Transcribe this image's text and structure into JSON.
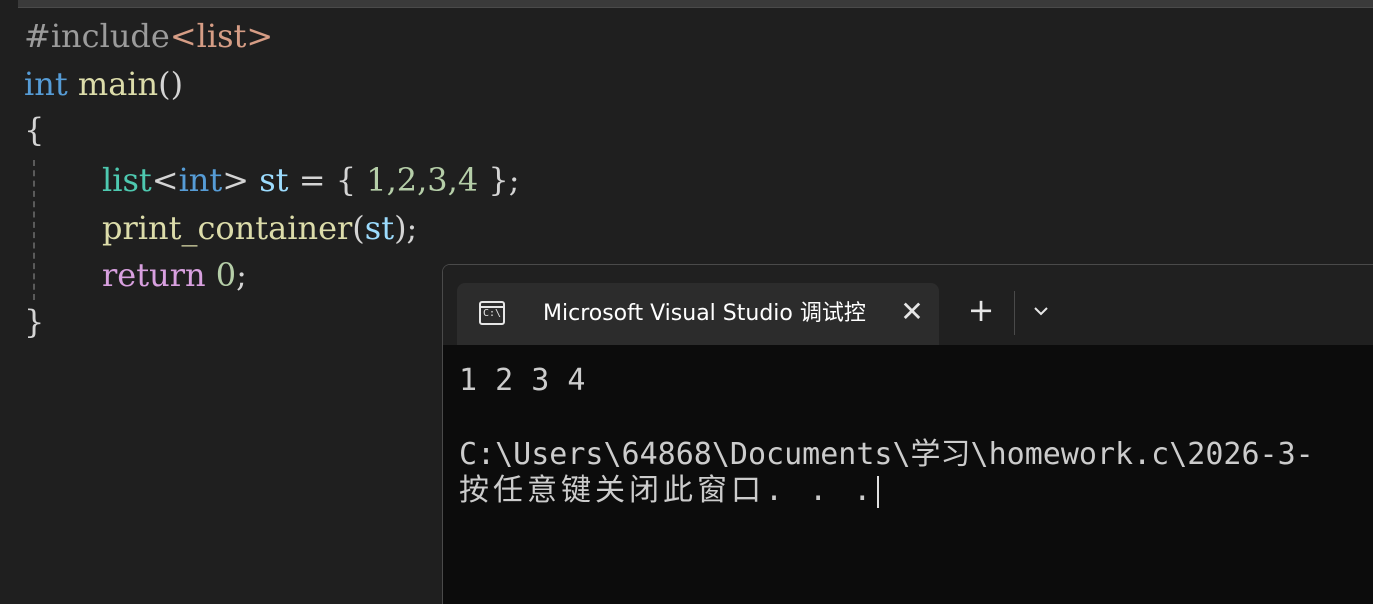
{
  "editor": {
    "lines": {
      "include_directive": "#include",
      "include_header": "<list>",
      "main_type": "int",
      "main_name": "main",
      "main_parens": "()",
      "open_brace": "{",
      "list_type": "list",
      "template_open": "<",
      "template_type": "int",
      "template_close": ">",
      "var_name": "st",
      "assign": " = { ",
      "init_values": "1,2,3,4",
      "init_close": " };",
      "call_name": "print_container",
      "call_open": "(",
      "call_arg": "st",
      "call_close": ");",
      "return_kw": "return",
      "return_value": "0",
      "return_semicolon": ";",
      "close_brace": "}"
    }
  },
  "terminal": {
    "tab_title": "Microsoft Visual Studio 调试控",
    "icons": {
      "tab_icon": "console-icon",
      "close": "close-icon",
      "new_tab": "plus-icon",
      "dropdown": "chevron-down-icon"
    },
    "close_glyph": "✕",
    "new_tab_glyph": "+",
    "output_line": "1 2 3 4",
    "path_line": "C:\\Users\\64868\\Documents\\学习\\homework.c\\2026-3-",
    "prompt_line": "按任意键关闭此窗口. . ."
  },
  "colors": {
    "editor_bg": "#1f1f1f",
    "terminal_bg": "#0c0c0c",
    "titlebar_bg": "#202020",
    "tab_bg": "#2c2c2c",
    "keyword": "#569cd6",
    "function": "#dcdcaa",
    "type": "#4ec9b0",
    "variable": "#9cdcfe",
    "number": "#b5cea8",
    "control": "#d8a0df",
    "string": "#d69d85"
  }
}
